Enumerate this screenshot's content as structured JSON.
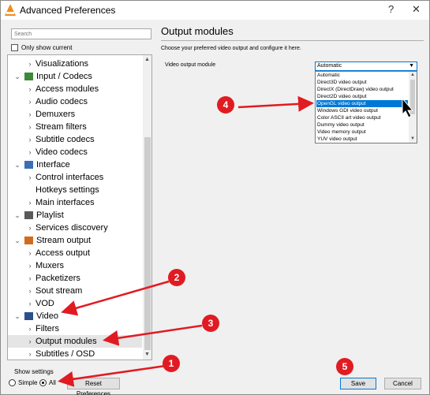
{
  "window": {
    "title": "Advanced Preferences",
    "help": "?",
    "close": "✕"
  },
  "sidebar": {
    "search_placeholder": "Search",
    "only_show_current": "Only show current",
    "items": [
      {
        "label": "Visualizations",
        "level": 1,
        "chev": "›",
        "icon": ""
      },
      {
        "label": "Input / Codecs",
        "level": 0,
        "chev": "⌄",
        "icon": "codec-icon"
      },
      {
        "label": "Access modules",
        "level": 1,
        "chev": "›",
        "icon": ""
      },
      {
        "label": "Audio codecs",
        "level": 1,
        "chev": "›",
        "icon": ""
      },
      {
        "label": "Demuxers",
        "level": 1,
        "chev": "›",
        "icon": ""
      },
      {
        "label": "Stream filters",
        "level": 1,
        "chev": "›",
        "icon": ""
      },
      {
        "label": "Subtitle codecs",
        "level": 1,
        "chev": "›",
        "icon": ""
      },
      {
        "label": "Video codecs",
        "level": 1,
        "chev": "›",
        "icon": ""
      },
      {
        "label": "Interface",
        "level": 0,
        "chev": "⌄",
        "icon": "interface-icon"
      },
      {
        "label": "Control interfaces",
        "level": 1,
        "chev": "›",
        "icon": ""
      },
      {
        "label": "Hotkeys settings",
        "level": 1,
        "chev": "",
        "icon": ""
      },
      {
        "label": "Main interfaces",
        "level": 1,
        "chev": "›",
        "icon": ""
      },
      {
        "label": "Playlist",
        "level": 0,
        "chev": "⌄",
        "icon": "playlist-icon"
      },
      {
        "label": "Services discovery",
        "level": 1,
        "chev": "›",
        "icon": ""
      },
      {
        "label": "Stream output",
        "level": 0,
        "chev": "⌄",
        "icon": "stream-output-icon"
      },
      {
        "label": "Access output",
        "level": 1,
        "chev": "›",
        "icon": ""
      },
      {
        "label": "Muxers",
        "level": 1,
        "chev": "›",
        "icon": ""
      },
      {
        "label": "Packetizers",
        "level": 1,
        "chev": "›",
        "icon": ""
      },
      {
        "label": "Sout stream",
        "level": 1,
        "chev": "›",
        "icon": ""
      },
      {
        "label": "VOD",
        "level": 1,
        "chev": "›",
        "icon": ""
      },
      {
        "label": "Video",
        "level": 0,
        "chev": "⌄",
        "icon": "video-icon"
      },
      {
        "label": "Filters",
        "level": 1,
        "chev": "›",
        "icon": ""
      },
      {
        "label": "Output modules",
        "level": 1,
        "chev": "›",
        "icon": "",
        "selected": true
      },
      {
        "label": "Subtitles / OSD",
        "level": 1,
        "chev": "›",
        "icon": ""
      }
    ]
  },
  "bottom": {
    "show_settings": "Show settings",
    "simple": "Simple",
    "all": "All",
    "reset": "Reset Preferences",
    "save": "Save",
    "cancel": "Cancel"
  },
  "main": {
    "title": "Output modules",
    "description": "Choose your preferred video output and configure it here.",
    "video_output_label": "Video output module",
    "combo_value": "Automatic",
    "dropdown_options": [
      "Automatic",
      "Direct3D video output",
      "DirectX (DirectDraw) video output",
      "Direct2D video output",
      "OpenGL video output",
      "Windows GDI video output",
      "Color ASCII art video output",
      "Dummy video output",
      "Video memory output",
      "YUV video output"
    ],
    "highlighted_index": 4
  },
  "annotations": {
    "badges": [
      "1",
      "2",
      "3",
      "4",
      "5"
    ],
    "color": "#e11b22"
  }
}
